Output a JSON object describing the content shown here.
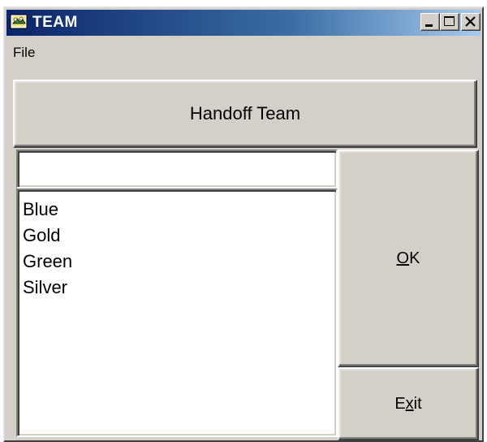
{
  "window": {
    "title": "TEAM",
    "controls": {
      "minimize": "minimize-icon",
      "maximize": "maximize-icon",
      "close": "close-icon"
    }
  },
  "menu": {
    "items": [
      "File"
    ]
  },
  "handoff_button": {
    "label": "Handoff Team"
  },
  "team_input": {
    "value": ""
  },
  "team_list": {
    "items": [
      "Blue",
      "Gold",
      "Green",
      "Silver"
    ]
  },
  "ok_button": {
    "mnemonic": "O",
    "rest": "K"
  },
  "exit_button": {
    "prefix": "E",
    "mnemonic": "x",
    "rest": "it"
  },
  "colors": {
    "face": "#d4d0c8",
    "title_start": "#0a246a",
    "title_end": "#a6caf0"
  }
}
